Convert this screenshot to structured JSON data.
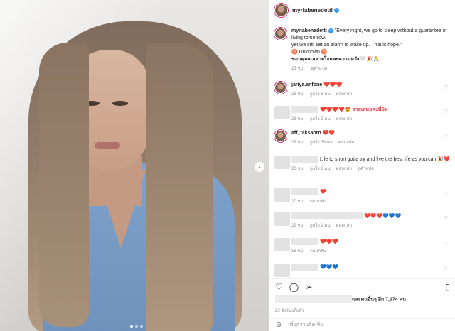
{
  "post": {
    "username": "myriabenedetti",
    "caption_line1": "\"Every night, we go to sleep without a guarantee of living tomorrow.",
    "caption_line2": "yet we still set an alarm to wake up. That is hope.\"",
    "caption_line3": "♉ Unknown ♉",
    "caption_line4": "ขอบคุณแลหายใจและความหวัง🤍 🎉🙏",
    "caption_time": "23 ชม.",
    "caption_translate": "ดูคำแปล"
  },
  "comments": [
    {
      "username": "jariya.anfone",
      "text": "❤️❤️❤️",
      "time": "23 ชม.",
      "likes": "ถูกใจ 8 คน",
      "reply": "ตอบกลับ"
    },
    {
      "username": "",
      "text": "❤️❤️❤️❤️😍 สวยเสมอค่ะพี่ษิท",
      "time": "23 ชม.",
      "likes": "ถูกใจ 2 คน",
      "reply": "ตอบกลับ"
    },
    {
      "username": "aff_taksaorn",
      "text": "❤️❤️",
      "time": "23 ชม.",
      "likes": "ถูกใจ 39 คน",
      "reply": "ตอบกลับ"
    },
    {
      "username": "",
      "text": "Life to short gotta try and live the best life as you can 🎉❤️",
      "time": "20 ชม.",
      "likes": "ถูกใจ 2 คน",
      "reply": "ตอบกลับ",
      "translate": "ดูคำแปล"
    },
    {
      "username": "",
      "text": "❤️",
      "time": "20 ชม.",
      "likes": "",
      "reply": "ตอบกลับ"
    },
    {
      "username": "",
      "text": "❤️❤️❤️💙💙💙",
      "time": "22 ชม.",
      "likes": "ถูกใจ 1 คน",
      "reply": "ตอบกลับ"
    },
    {
      "username": "",
      "text": "❤️❤️❤️",
      "time": "18 ชม.",
      "likes": "",
      "reply": "ตอบกลับ"
    },
    {
      "username": "",
      "text": "💙💙💙",
      "time": "",
      "likes": "",
      "reply": ""
    }
  ],
  "footer": {
    "likes_suffix": "และคนอื่นๆ อีก 7,174 คน",
    "time": "23 ชั่วโมงที่แล้ว",
    "add_comment_placeholder": "เพิ่มความคิดเห็น"
  },
  "icons": [
    "heart-icon",
    "comment-icon",
    "share-icon",
    "bookmark-icon",
    "emoji-icon",
    "chevron-right-icon",
    "verified-icon"
  ],
  "colors": {
    "verified": "#3897f0",
    "like_red": "#ed4956"
  }
}
